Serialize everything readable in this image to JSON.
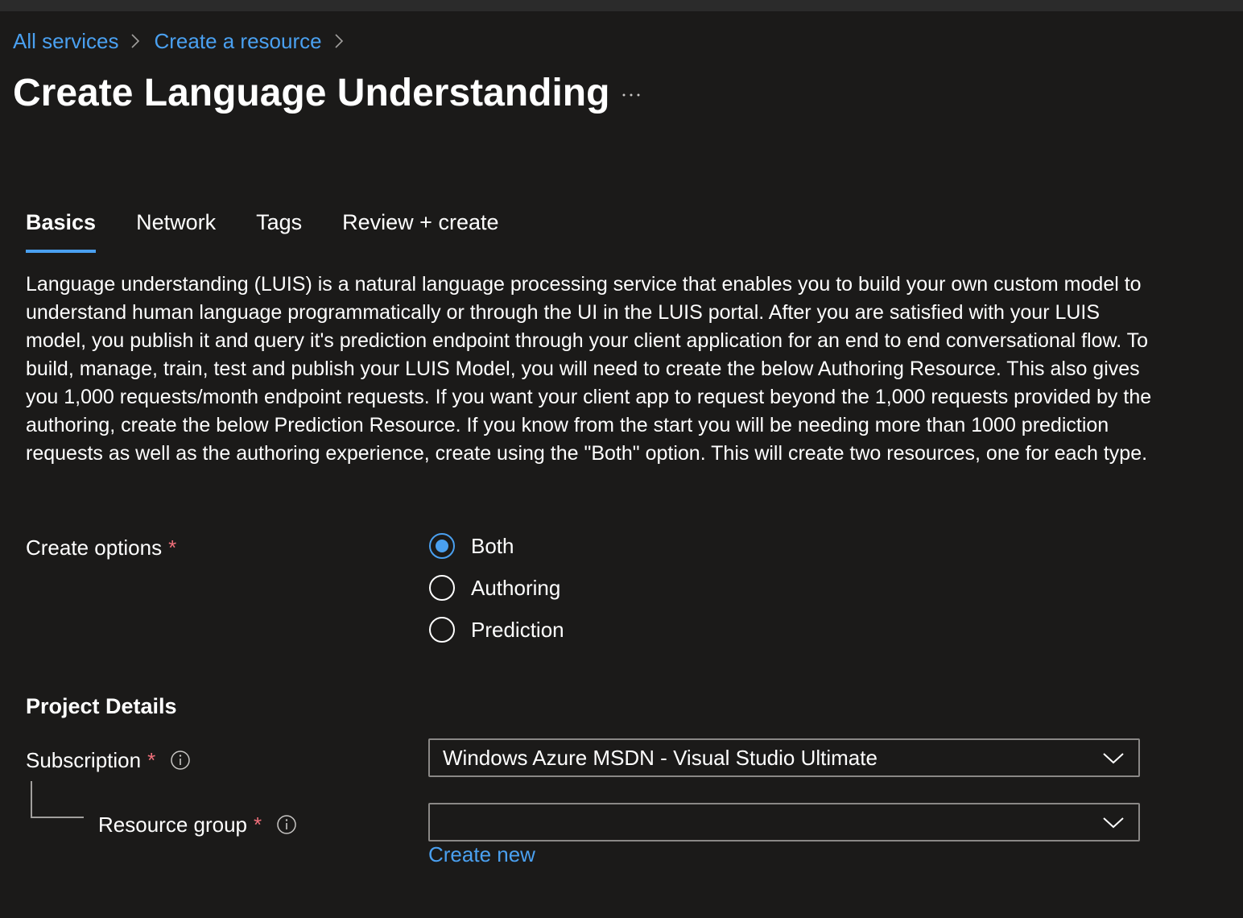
{
  "breadcrumb": {
    "items": [
      {
        "label": "All services"
      },
      {
        "label": "Create a resource"
      }
    ]
  },
  "page": {
    "title": "Create Language Understanding",
    "more_icon": "ellipsis-icon"
  },
  "tabs": [
    {
      "label": "Basics",
      "active": true
    },
    {
      "label": "Network",
      "active": false
    },
    {
      "label": "Tags",
      "active": false
    },
    {
      "label": "Review + create",
      "active": false
    }
  ],
  "description": "Language understanding (LUIS) is a natural language processing service that enables you to build your own custom model to understand human language programmatically or through the UI in the LUIS portal. After you are satisfied with your LUIS model, you publish it and query it's prediction endpoint through your client application for an end to end conversational flow. To build, manage, train, test and publish your LUIS Model, you will need to create the below Authoring Resource. This also gives you 1,000 requests/month endpoint requests. If you want your client app to request beyond the 1,000 requests provided by the authoring, create the below Prediction Resource. If you know from the start you will be needing more than 1000 prediction requests as well as the authoring experience, create using the \"Both\" option. This will create two resources, one for each type.",
  "create_options": {
    "label": "Create options",
    "required_marker": "*",
    "selected": "Both",
    "options": [
      {
        "label": "Both",
        "selected": true
      },
      {
        "label": "Authoring",
        "selected": false
      },
      {
        "label": "Prediction",
        "selected": false
      }
    ]
  },
  "project_details": {
    "heading": "Project Details",
    "subscription": {
      "label": "Subscription",
      "required_marker": "*",
      "value": "Windows Azure MSDN - Visual Studio Ultimate"
    },
    "resource_group": {
      "label": "Resource group",
      "required_marker": "*",
      "value": "",
      "create_new_label": "Create new"
    }
  },
  "colors": {
    "background": "#1b1a19",
    "accent": "#4aa0f0",
    "required": "#f1707b",
    "border": "#8a8886"
  }
}
